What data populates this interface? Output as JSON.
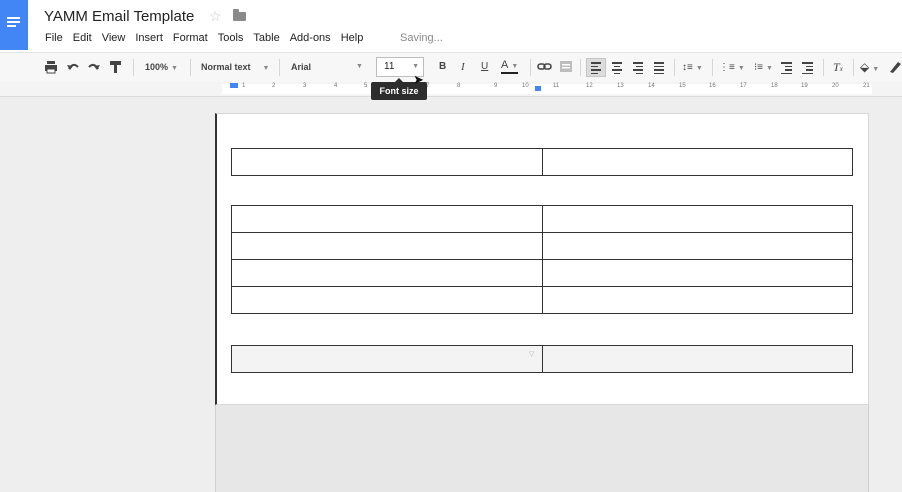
{
  "app": {
    "title": "YAMM Email Template",
    "save_status": "Saving..."
  },
  "menu": [
    "File",
    "Edit",
    "View",
    "Insert",
    "Format",
    "Tools",
    "Table",
    "Add-ons",
    "Help"
  ],
  "toolbar": {
    "zoom": "100%",
    "style": "Normal text",
    "font": "Arial",
    "font_size": "11",
    "bold": "B",
    "italic": "I",
    "underline": "U",
    "text_color": "A",
    "tooltip": "Font size"
  },
  "ruler": [
    "1",
    "2",
    "3",
    "4",
    "5",
    "6",
    "7",
    "8",
    "9",
    "10",
    "11",
    "12",
    "13",
    "14",
    "15",
    "16",
    "17",
    "18",
    "19",
    "20",
    "21"
  ],
  "tables": [
    {
      "rows": 1,
      "cols": 2
    },
    {
      "rows": 4,
      "cols": 2
    },
    {
      "rows": 1,
      "cols": 2
    }
  ],
  "colors": {
    "accent": "#4285f4",
    "tooltip_bg": "#2d2d2d"
  }
}
